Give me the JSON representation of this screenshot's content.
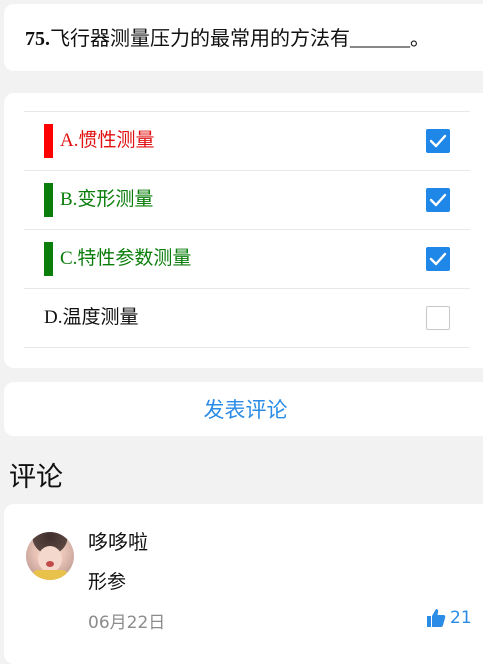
{
  "question": {
    "number": "75.",
    "text": "飞行器测量压力的最常用的方法有______。"
  },
  "options": [
    {
      "label": "A.惯性测量",
      "checked": true,
      "bar_color": "#ff0000",
      "text_color": "#e11111"
    },
    {
      "label": "B.变形测量",
      "checked": true,
      "bar_color": "#0a7d0a",
      "text_color": "#0a7d0a"
    },
    {
      "label": "C.特性参数测量",
      "checked": true,
      "bar_color": "#0a7d0a",
      "text_color": "#0a7d0a"
    },
    {
      "label": "D.温度测量",
      "checked": false,
      "bar_color": "",
      "text_color": "#111111"
    }
  ],
  "comment_button": {
    "label": "发表评论"
  },
  "comments_section": {
    "title": "评论"
  },
  "comments": [
    {
      "username": "哆哆啦",
      "body": "形参",
      "date": "06月22日",
      "likes": "21"
    }
  ],
  "colors": {
    "accent": "#2a8ce6",
    "checkbox": "#1f87e8"
  },
  "icons": {
    "check": "checkmark-icon",
    "like": "thumbs-up-icon"
  }
}
